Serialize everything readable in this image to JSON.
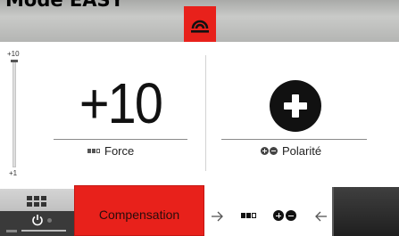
{
  "header": {
    "title": "Mode EASY",
    "mode_icon": "compensation-coil-icon",
    "accent_color": "#e8211b"
  },
  "level_scale": {
    "max_label": "+10",
    "min_label": "+1",
    "current_fraction": 1.0
  },
  "force_panel": {
    "value": "+10",
    "label": "Force",
    "icon": "level-bars-icon"
  },
  "polarity_panel": {
    "state_icon": "plus-circle-icon",
    "label": "Polarité",
    "icon": "plus-minus-icon"
  },
  "bottom_bar": {
    "menu_icon": "grid-icon",
    "power_icon": "power-icon",
    "compensation_label": "Compensation",
    "nav_left_icon": "arrow-right-icon",
    "nav_right_icon": "arrow-left-icon",
    "status_level_icon": "level-bars-icon",
    "status_polarity_icon": "plus-minus-icon"
  }
}
